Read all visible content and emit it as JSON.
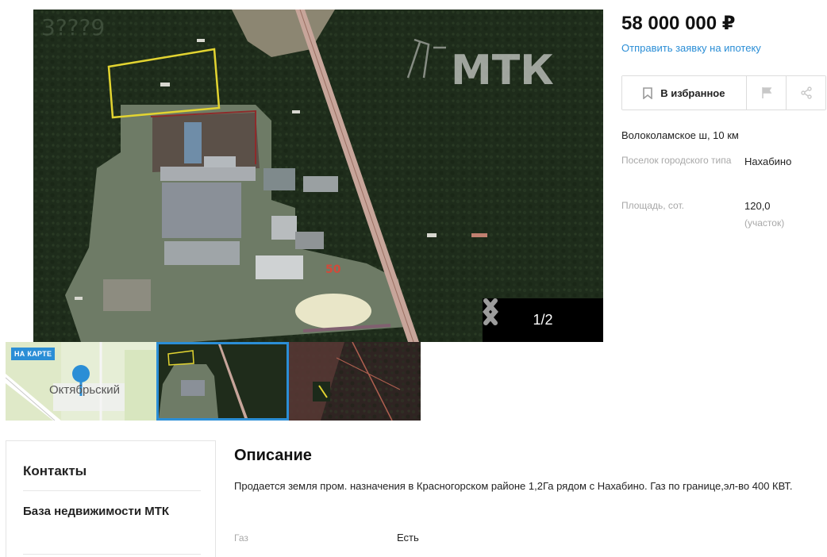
{
  "gallery": {
    "watermark": "МТК",
    "overlay_number": "50",
    "counter": "1/2",
    "map_badge": "НА КАРТЕ",
    "map_town": "Октябрьский"
  },
  "listing": {
    "price": "58 000 000 ₽",
    "mortgage_link": "Отправить заявку на ипотеку",
    "favorite_label": "В избранное",
    "road": "Волоколамское ш, 10 км",
    "properties": [
      {
        "label": "Поселок городского типа",
        "value": "Нахабино",
        "sub": ""
      },
      {
        "label": "Площадь, сот.",
        "value": "120,0",
        "sub": "(участок)"
      }
    ]
  },
  "contacts": {
    "title": "Контакты",
    "agency": "База недвижимости МТК"
  },
  "description": {
    "title": "Описание",
    "text": "Продается земля пром. назначения в Красногорском районе 1,2Га рядом с Нахабино. Газ по границе,эл-во 400 КВТ.",
    "features": [
      {
        "label": "Газ",
        "value": "Есть"
      }
    ]
  },
  "colors": {
    "accent": "#2b8ed6",
    "counter_bg": "#000000",
    "plot_outline": "#e2d431"
  }
}
